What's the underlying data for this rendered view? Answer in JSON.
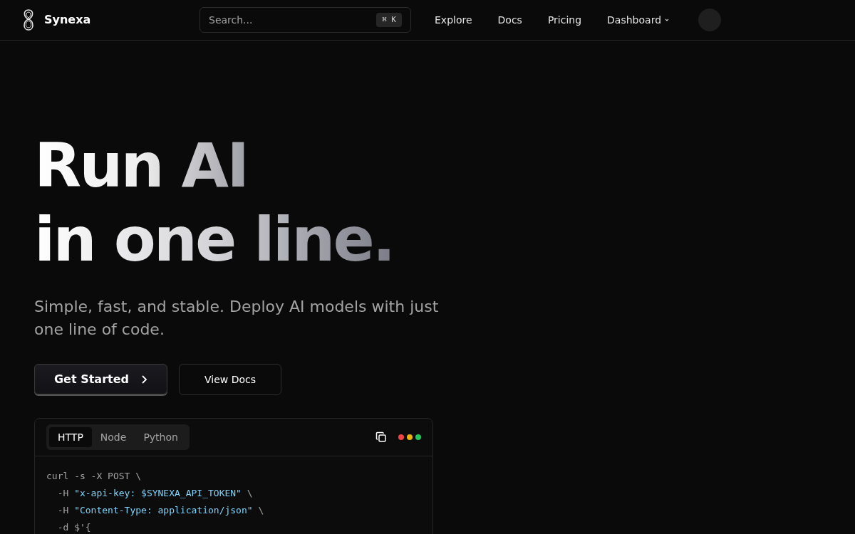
{
  "brand": "Synexa",
  "search": {
    "placeholder": "Search...",
    "shortcut": "⌘ K"
  },
  "nav": [
    {
      "label": "Explore",
      "dropdown": false
    },
    {
      "label": "Docs",
      "dropdown": false
    },
    {
      "label": "Pricing",
      "dropdown": false
    },
    {
      "label": "Dashboard",
      "dropdown": true
    }
  ],
  "hero": {
    "title_lines": [
      "Run AI",
      "in one line."
    ],
    "subtitle": "Simple, fast, and stable. Deploy AI models with just one line of code."
  },
  "buttons": [
    {
      "label": "Get Started",
      "kind": "primary"
    },
    {
      "label": "View Docs",
      "kind": "secondary"
    }
  ],
  "code_panel": {
    "tabs": [
      {
        "label": "HTTP",
        "selected": true
      },
      {
        "label": "Node",
        "selected": false
      },
      {
        "label": "Python",
        "selected": false
      }
    ],
    "window_dots": [
      {
        "color": "#ef4444"
      },
      {
        "color": "#eab308"
      },
      {
        "color": "#22c55e"
      }
    ],
    "lines": [
      [
        {
          "kind": "plain",
          "text": "curl -s -X POST \\"
        }
      ],
      [
        {
          "kind": "plain",
          "text": "  -H "
        },
        {
          "kind": "string",
          "text": "\"x-api-key: $SYNEXA_API_TOKEN\""
        },
        {
          "kind": "plain",
          "text": " \\"
        }
      ],
      [
        {
          "kind": "plain",
          "text": "  -H "
        },
        {
          "kind": "string",
          "text": "\"Content-Type: application/json\""
        },
        {
          "kind": "plain",
          "text": " \\"
        }
      ],
      [
        {
          "kind": "plain",
          "text": "  -d $'{"
        }
      ]
    ]
  }
}
